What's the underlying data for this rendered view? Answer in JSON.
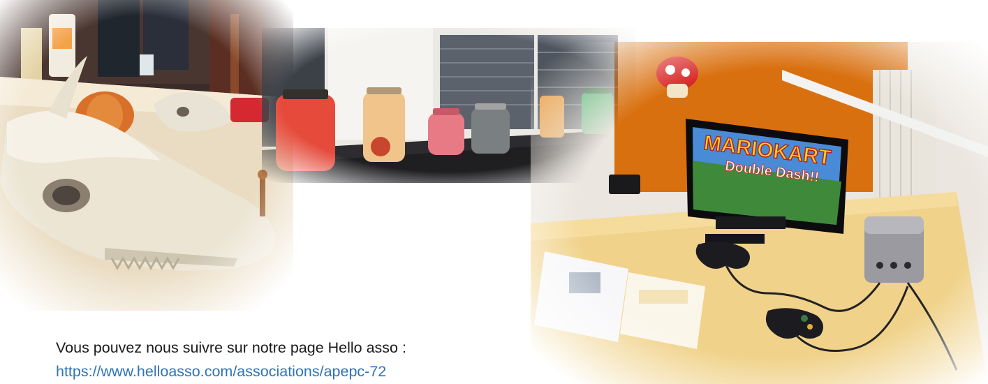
{
  "footer": {
    "follow_text": "Vous pouvez nous suivre sur notre page Hello asso :",
    "link_text": "https://www.helloasso.com/associations/apepc-72"
  },
  "photos": {
    "game": {
      "screen_title": "MARIOKART",
      "screen_subtitle": "Double Dash!!"
    }
  },
  "colors": {
    "link": "#2e74b5",
    "text": "#1a1a1a",
    "orange_wall": "#d9700f",
    "table": "#f0d28a"
  }
}
